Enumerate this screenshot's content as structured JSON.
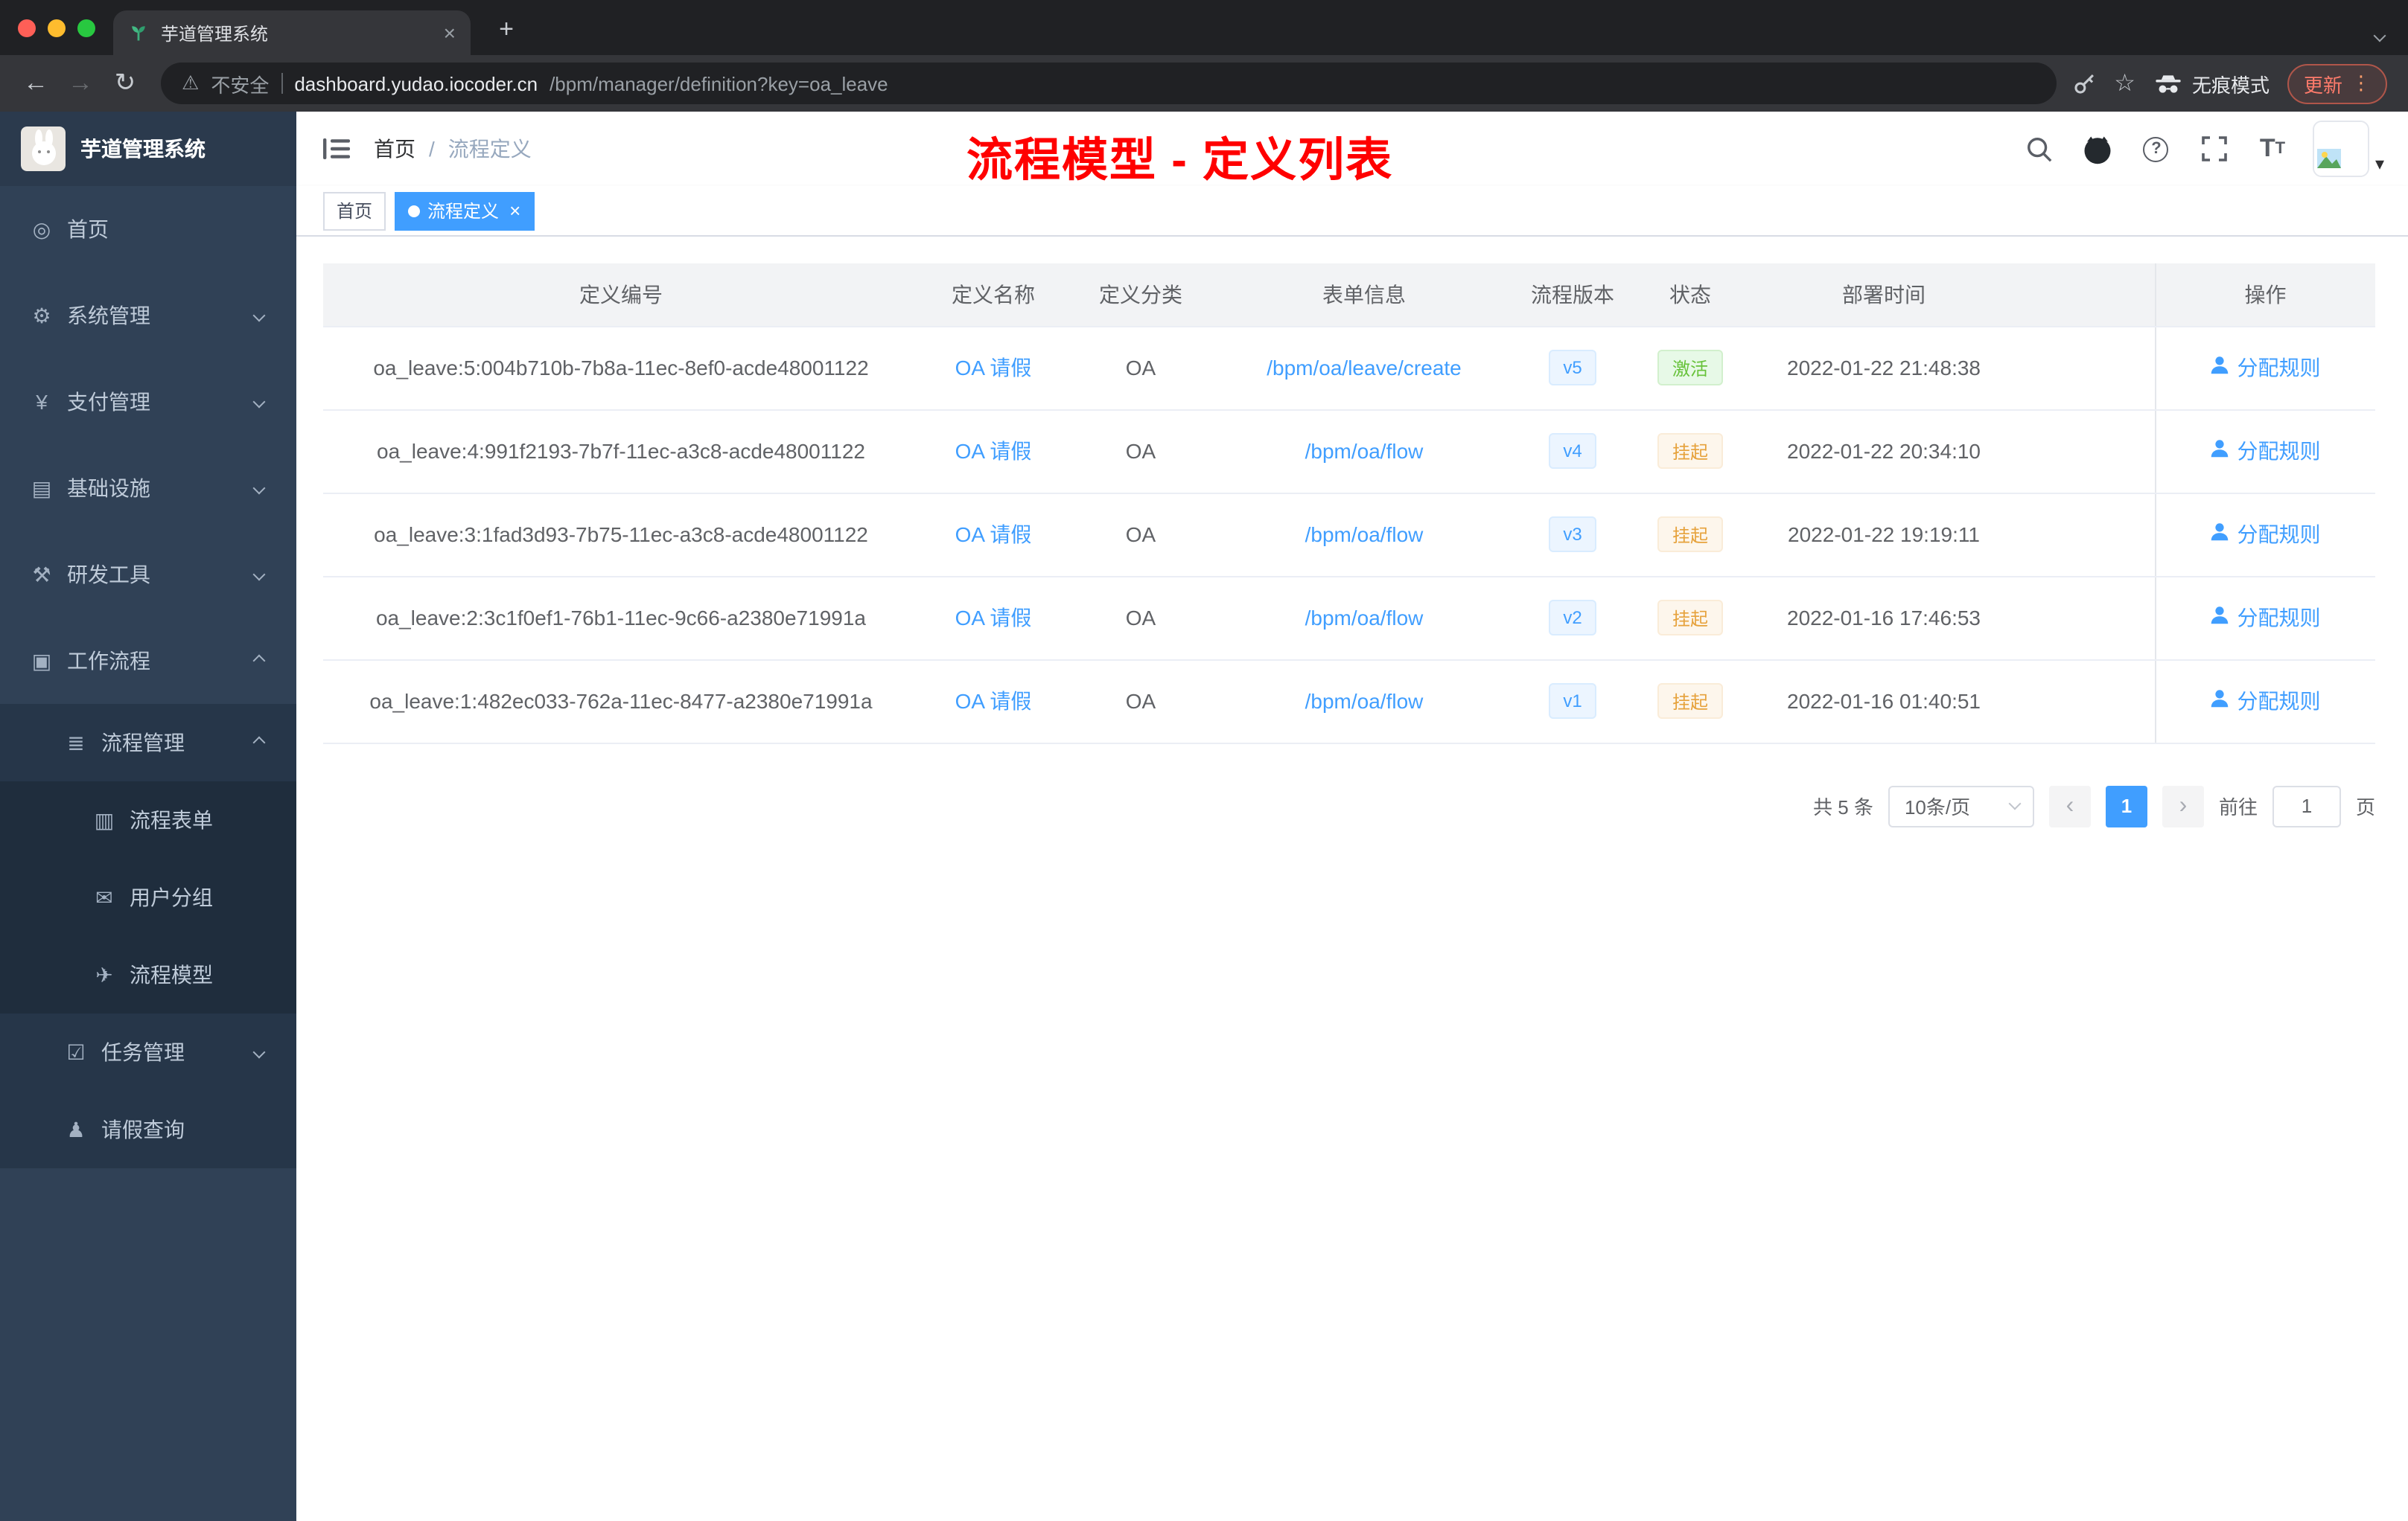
{
  "colors": {
    "primary": "#409eff",
    "success": "#67c23a",
    "warning": "#e6a23c",
    "annotation": "#ff0000"
  },
  "icons": {
    "close": "×",
    "plus": "+",
    "back": "←",
    "forward": "→",
    "reload": "↻",
    "warning": "⚠",
    "star": "☆",
    "dots_vertical": "⋮",
    "prev": "‹",
    "next": "›",
    "caret_down": "▾",
    "question": "?",
    "font_large": "T",
    "font_small": "T"
  },
  "browser": {
    "tab_title": "芋道管理系统",
    "security_label": "不安全",
    "url_host": "dashboard.yudao.iocoder.cn",
    "url_path": "/bpm/manager/definition?key=oa_leave",
    "incognito_label": "无痕模式",
    "update_label": "更新"
  },
  "sidebar": {
    "logo_title": "芋道管理系统",
    "items": [
      {
        "key": "home",
        "label": "首页",
        "icon": "dashboard-icon",
        "level": 0
      },
      {
        "key": "system-manage",
        "label": "系统管理",
        "icon": "gear-icon",
        "level": 0,
        "arrow": "down"
      },
      {
        "key": "payment-manage",
        "label": "支付管理",
        "icon": "yen-icon",
        "level": 0,
        "arrow": "down"
      },
      {
        "key": "infrastructure",
        "label": "基础设施",
        "icon": "infra-icon",
        "level": 0,
        "arrow": "down"
      },
      {
        "key": "dev-tools",
        "label": "研发工具",
        "icon": "tools-icon",
        "level": 0,
        "arrow": "down"
      },
      {
        "key": "workflow",
        "label": "工作流程",
        "icon": "workflow-icon",
        "level": 0,
        "arrow": "up"
      },
      {
        "key": "process-manage",
        "label": "流程管理",
        "icon": "process-icon",
        "level": 1,
        "arrow": "up"
      },
      {
        "key": "process-form",
        "label": "流程表单",
        "icon": "form-icon",
        "level": 2
      },
      {
        "key": "user-group",
        "label": "用户分组",
        "icon": "user-group-icon",
        "level": 2
      },
      {
        "key": "process-model",
        "label": "流程模型",
        "icon": "model-icon",
        "level": 2
      },
      {
        "key": "task-manage",
        "label": "任务管理",
        "icon": "task-icon",
        "level": 1,
        "arrow": "down"
      },
      {
        "key": "leave-query",
        "label": "请假查询",
        "icon": "person-icon",
        "level": 1
      }
    ]
  },
  "navbar": {
    "breadcrumb": [
      {
        "key": "home",
        "label": "首页"
      },
      {
        "key": "process-definition",
        "label": "流程定义"
      }
    ],
    "separator": "/",
    "annotation": "流程模型 - 定义列表"
  },
  "tags_view": [
    {
      "key": "home",
      "label": "首页",
      "active": false,
      "closable": false
    },
    {
      "key": "process-definition",
      "label": "流程定义",
      "active": true,
      "closable": true
    }
  ],
  "table": {
    "columns": [
      {
        "key": "id",
        "label": "定义编号"
      },
      {
        "key": "name",
        "label": "定义名称"
      },
      {
        "key": "category",
        "label": "定义分类"
      },
      {
        "key": "form",
        "label": "表单信息"
      },
      {
        "key": "version",
        "label": "流程版本"
      },
      {
        "key": "status",
        "label": "状态"
      },
      {
        "key": "time",
        "label": "部署时间"
      },
      {
        "key": "spacer",
        "label": ""
      },
      {
        "key": "action",
        "label": "操作"
      }
    ],
    "rows": [
      {
        "id": "oa_leave:5:004b710b-7b8a-11ec-8ef0-acde48001122",
        "name": "OA 请假",
        "category": "OA",
        "form": "/bpm/oa/leave/create",
        "version": "v5",
        "status": "激活",
        "status_type": "success",
        "time": "2022-01-22 21:48:38",
        "action": "分配规则"
      },
      {
        "id": "oa_leave:4:991f2193-7b7f-11ec-a3c8-acde48001122",
        "name": "OA 请假",
        "category": "OA",
        "form": "/bpm/oa/flow",
        "version": "v4",
        "status": "挂起",
        "status_type": "warning",
        "time": "2022-01-22 20:34:10",
        "action": "分配规则"
      },
      {
        "id": "oa_leave:3:1fad3d93-7b75-11ec-a3c8-acde48001122",
        "name": "OA 请假",
        "category": "OA",
        "form": "/bpm/oa/flow",
        "version": "v3",
        "status": "挂起",
        "status_type": "warning",
        "time": "2022-01-22 19:19:11",
        "action": "分配规则"
      },
      {
        "id": "oa_leave:2:3c1f0ef1-76b1-11ec-9c66-a2380e71991a",
        "name": "OA 请假",
        "category": "OA",
        "form": "/bpm/oa/flow",
        "version": "v2",
        "status": "挂起",
        "status_type": "warning",
        "time": "2022-01-16 17:46:53",
        "action": "分配规则"
      },
      {
        "id": "oa_leave:1:482ec033-762a-11ec-8477-a2380e71991a",
        "name": "OA 请假",
        "category": "OA",
        "form": "/bpm/oa/flow",
        "version": "v1",
        "status": "挂起",
        "status_type": "warning",
        "time": "2022-01-16 01:40:51",
        "action": "分配规则"
      }
    ]
  },
  "pagination": {
    "total_text": "共 5 条",
    "page_size_text": "10条/页",
    "current_page": "1",
    "goto_prefix": "前往",
    "goto_value": "1",
    "goto_suffix": "页"
  }
}
